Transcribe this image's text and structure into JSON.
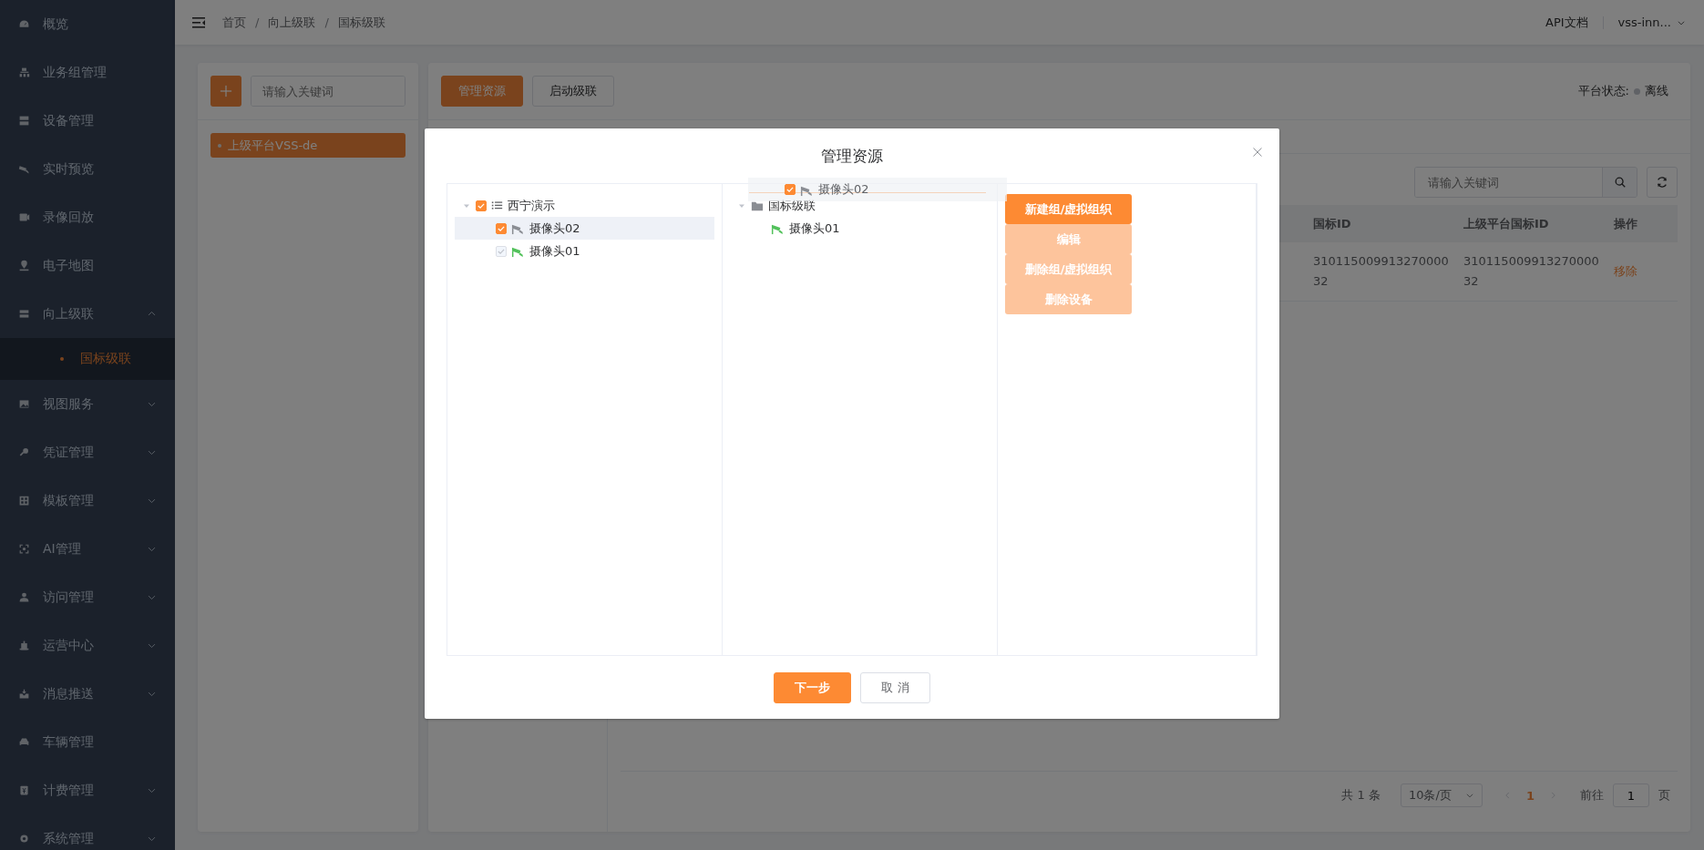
{
  "sidebar": {
    "items": [
      {
        "label": "概览",
        "kind": "link"
      },
      {
        "label": "业务组管理",
        "kind": "link"
      },
      {
        "label": "设备管理",
        "kind": "link"
      },
      {
        "label": "实时预览",
        "kind": "link"
      },
      {
        "label": "录像回放",
        "kind": "link"
      },
      {
        "label": "电子地图",
        "kind": "link"
      },
      {
        "label": "向上级联",
        "kind": "group",
        "expanded": true,
        "children": [
          {
            "label": "国标级联",
            "selected": true
          }
        ]
      },
      {
        "label": "视图服务",
        "kind": "group",
        "expanded": false
      },
      {
        "label": "凭证管理",
        "kind": "group",
        "expanded": false
      },
      {
        "label": "模板管理",
        "kind": "group",
        "expanded": false
      },
      {
        "label": "AI管理",
        "kind": "group",
        "expanded": false
      },
      {
        "label": "访问管理",
        "kind": "group",
        "expanded": false
      },
      {
        "label": "运营中心",
        "kind": "group",
        "expanded": false
      },
      {
        "label": "消息推送",
        "kind": "group",
        "expanded": false
      },
      {
        "label": "车辆管理",
        "kind": "link"
      },
      {
        "label": "计费管理",
        "kind": "group",
        "expanded": false
      },
      {
        "label": "系统管理",
        "kind": "group",
        "expanded": false
      }
    ]
  },
  "header": {
    "breadcrumb": [
      "首页",
      "向上级联",
      "国标级联"
    ],
    "separators": [
      "/",
      "/"
    ],
    "docs_link": "API文档",
    "user": "vss-inn..."
  },
  "left_panel": {
    "search": {
      "placeholder": "请输入关键词"
    },
    "platforms": [
      {
        "label": "上级平台VSS-de",
        "selected": true
      }
    ]
  },
  "main": {
    "buttons": [
      {
        "label": "管理资源",
        "primary": true
      },
      {
        "label": "启动级联",
        "primary": false
      }
    ],
    "status_label": "平台状态:",
    "status": {
      "text": "离线",
      "online": false
    },
    "table": {
      "search": {
        "placeholder": "请输入关键词"
      },
      "columns": [
        "国标ID",
        "上级平台国标ID",
        "操作"
      ],
      "rows": [
        {
          "cells": [
            "31011500991327000032",
            "31011500991327000032"
          ],
          "action": "移除"
        }
      ]
    },
    "pagination": {
      "total": "共 1 条",
      "page_size": "10条/页",
      "pages": [
        {
          "label": "1",
          "selected": true
        }
      ],
      "goto_label": "前往",
      "goto_value": "1",
      "page_suffix": "页"
    }
  },
  "dialog": {
    "title": "管理资源",
    "source_tree": [
      {
        "label": "西宁演示",
        "kind": "group",
        "expanded": true,
        "checked": true,
        "disabled": false,
        "selected": false,
        "children": [
          {
            "label": "摄像头02",
            "kind": "camera",
            "online": false,
            "checked": true,
            "disabled": false,
            "selected": true
          },
          {
            "label": "摄像头01",
            "kind": "camera",
            "online": true,
            "checked": true,
            "disabled": true,
            "selected": false
          }
        ]
      }
    ],
    "target_tree": [
      {
        "label": "国标级联",
        "kind": "folder",
        "expanded": true,
        "children": [
          {
            "label": "摄像头01",
            "kind": "camera",
            "online": true
          }
        ]
      }
    ],
    "drag_ghost": {
      "label": "摄像头02",
      "checked": true,
      "online": false
    },
    "actions": [
      {
        "label": "新建组/虚拟组织",
        "disabled": false
      },
      {
        "label": "编辑",
        "disabled": true
      },
      {
        "label": "删除组/虚拟组织",
        "disabled": true
      },
      {
        "label": "删除设备",
        "disabled": true
      }
    ],
    "footer": [
      {
        "label": "下一步",
        "primary": true
      },
      {
        "label": "取 消",
        "primary": false
      }
    ]
  }
}
